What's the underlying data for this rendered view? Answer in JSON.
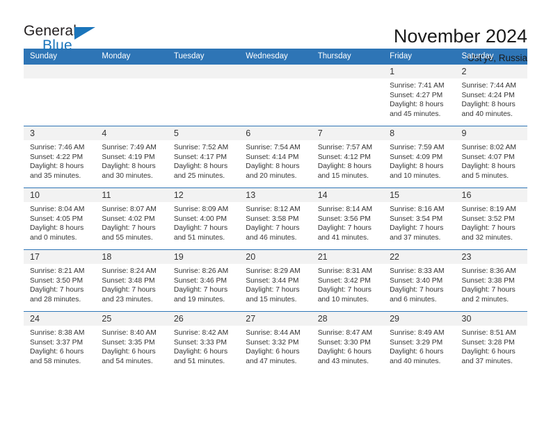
{
  "brand": {
    "name_part1": "General",
    "name_part2": "Blue",
    "triangle_color": "#1b75bb"
  },
  "header": {
    "title": "November 2024",
    "location": "Ust'ye, Russia"
  },
  "calendar": {
    "accent_color": "#2e75b6",
    "daynum_band_color": "#f2f2f2",
    "weekday_headers": [
      "Sunday",
      "Monday",
      "Tuesday",
      "Wednesday",
      "Thursday",
      "Friday",
      "Saturday"
    ],
    "weeks": [
      [
        {
          "day": "",
          "lines": []
        },
        {
          "day": "",
          "lines": []
        },
        {
          "day": "",
          "lines": []
        },
        {
          "day": "",
          "lines": []
        },
        {
          "day": "",
          "lines": []
        },
        {
          "day": "1",
          "lines": [
            "Sunrise: 7:41 AM",
            "Sunset: 4:27 PM",
            "Daylight: 8 hours",
            "and 45 minutes."
          ]
        },
        {
          "day": "2",
          "lines": [
            "Sunrise: 7:44 AM",
            "Sunset: 4:24 PM",
            "Daylight: 8 hours",
            "and 40 minutes."
          ]
        }
      ],
      [
        {
          "day": "3",
          "lines": [
            "Sunrise: 7:46 AM",
            "Sunset: 4:22 PM",
            "Daylight: 8 hours",
            "and 35 minutes."
          ]
        },
        {
          "day": "4",
          "lines": [
            "Sunrise: 7:49 AM",
            "Sunset: 4:19 PM",
            "Daylight: 8 hours",
            "and 30 minutes."
          ]
        },
        {
          "day": "5",
          "lines": [
            "Sunrise: 7:52 AM",
            "Sunset: 4:17 PM",
            "Daylight: 8 hours",
            "and 25 minutes."
          ]
        },
        {
          "day": "6",
          "lines": [
            "Sunrise: 7:54 AM",
            "Sunset: 4:14 PM",
            "Daylight: 8 hours",
            "and 20 minutes."
          ]
        },
        {
          "day": "7",
          "lines": [
            "Sunrise: 7:57 AM",
            "Sunset: 4:12 PM",
            "Daylight: 8 hours",
            "and 15 minutes."
          ]
        },
        {
          "day": "8",
          "lines": [
            "Sunrise: 7:59 AM",
            "Sunset: 4:09 PM",
            "Daylight: 8 hours",
            "and 10 minutes."
          ]
        },
        {
          "day": "9",
          "lines": [
            "Sunrise: 8:02 AM",
            "Sunset: 4:07 PM",
            "Daylight: 8 hours",
            "and 5 minutes."
          ]
        }
      ],
      [
        {
          "day": "10",
          "lines": [
            "Sunrise: 8:04 AM",
            "Sunset: 4:05 PM",
            "Daylight: 8 hours",
            "and 0 minutes."
          ]
        },
        {
          "day": "11",
          "lines": [
            "Sunrise: 8:07 AM",
            "Sunset: 4:02 PM",
            "Daylight: 7 hours",
            "and 55 minutes."
          ]
        },
        {
          "day": "12",
          "lines": [
            "Sunrise: 8:09 AM",
            "Sunset: 4:00 PM",
            "Daylight: 7 hours",
            "and 51 minutes."
          ]
        },
        {
          "day": "13",
          "lines": [
            "Sunrise: 8:12 AM",
            "Sunset: 3:58 PM",
            "Daylight: 7 hours",
            "and 46 minutes."
          ]
        },
        {
          "day": "14",
          "lines": [
            "Sunrise: 8:14 AM",
            "Sunset: 3:56 PM",
            "Daylight: 7 hours",
            "and 41 minutes."
          ]
        },
        {
          "day": "15",
          "lines": [
            "Sunrise: 8:16 AM",
            "Sunset: 3:54 PM",
            "Daylight: 7 hours",
            "and 37 minutes."
          ]
        },
        {
          "day": "16",
          "lines": [
            "Sunrise: 8:19 AM",
            "Sunset: 3:52 PM",
            "Daylight: 7 hours",
            "and 32 minutes."
          ]
        }
      ],
      [
        {
          "day": "17",
          "lines": [
            "Sunrise: 8:21 AM",
            "Sunset: 3:50 PM",
            "Daylight: 7 hours",
            "and 28 minutes."
          ]
        },
        {
          "day": "18",
          "lines": [
            "Sunrise: 8:24 AM",
            "Sunset: 3:48 PM",
            "Daylight: 7 hours",
            "and 23 minutes."
          ]
        },
        {
          "day": "19",
          "lines": [
            "Sunrise: 8:26 AM",
            "Sunset: 3:46 PM",
            "Daylight: 7 hours",
            "and 19 minutes."
          ]
        },
        {
          "day": "20",
          "lines": [
            "Sunrise: 8:29 AM",
            "Sunset: 3:44 PM",
            "Daylight: 7 hours",
            "and 15 minutes."
          ]
        },
        {
          "day": "21",
          "lines": [
            "Sunrise: 8:31 AM",
            "Sunset: 3:42 PM",
            "Daylight: 7 hours",
            "and 10 minutes."
          ]
        },
        {
          "day": "22",
          "lines": [
            "Sunrise: 8:33 AM",
            "Sunset: 3:40 PM",
            "Daylight: 7 hours",
            "and 6 minutes."
          ]
        },
        {
          "day": "23",
          "lines": [
            "Sunrise: 8:36 AM",
            "Sunset: 3:38 PM",
            "Daylight: 7 hours",
            "and 2 minutes."
          ]
        }
      ],
      [
        {
          "day": "24",
          "lines": [
            "Sunrise: 8:38 AM",
            "Sunset: 3:37 PM",
            "Daylight: 6 hours",
            "and 58 minutes."
          ]
        },
        {
          "day": "25",
          "lines": [
            "Sunrise: 8:40 AM",
            "Sunset: 3:35 PM",
            "Daylight: 6 hours",
            "and 54 minutes."
          ]
        },
        {
          "day": "26",
          "lines": [
            "Sunrise: 8:42 AM",
            "Sunset: 3:33 PM",
            "Daylight: 6 hours",
            "and 51 minutes."
          ]
        },
        {
          "day": "27",
          "lines": [
            "Sunrise: 8:44 AM",
            "Sunset: 3:32 PM",
            "Daylight: 6 hours",
            "and 47 minutes."
          ]
        },
        {
          "day": "28",
          "lines": [
            "Sunrise: 8:47 AM",
            "Sunset: 3:30 PM",
            "Daylight: 6 hours",
            "and 43 minutes."
          ]
        },
        {
          "day": "29",
          "lines": [
            "Sunrise: 8:49 AM",
            "Sunset: 3:29 PM",
            "Daylight: 6 hours",
            "and 40 minutes."
          ]
        },
        {
          "day": "30",
          "lines": [
            "Sunrise: 8:51 AM",
            "Sunset: 3:28 PM",
            "Daylight: 6 hours",
            "and 37 minutes."
          ]
        }
      ]
    ]
  }
}
